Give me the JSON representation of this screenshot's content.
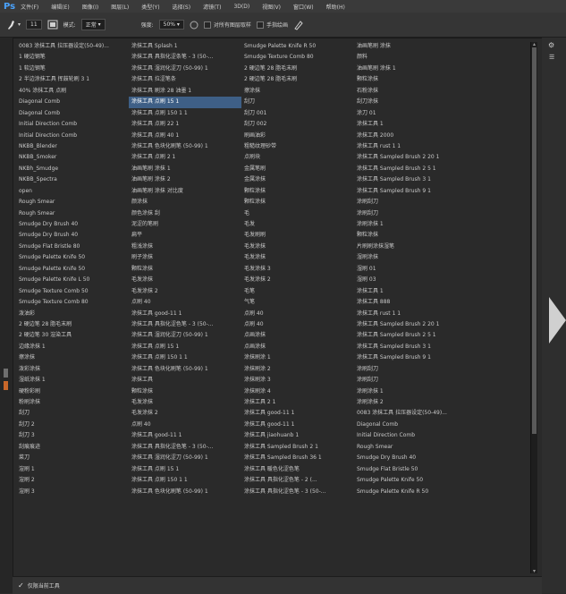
{
  "app": {
    "logo": "Ps"
  },
  "menu": [
    "文件(F)",
    "编辑(E)",
    "图像(I)",
    "图层(L)",
    "类型(Y)",
    "选择(S)",
    "滤镜(T)",
    "3D(D)",
    "视图(V)",
    "窗口(W)",
    "帮助(H)"
  ],
  "options": {
    "brush_size": "11",
    "mode_label": "模式:",
    "mode_value": "正常",
    "strength_label": "强度:",
    "strength_value": "50%",
    "sample_all_label": "对所有图层取样",
    "finger_label": "手指绘画"
  },
  "presets": {
    "columns": [
      [
        "0083 涂抹工具 拉压器设定(50-49)...",
        "1 硬边钢笔",
        "1 软边钢笔",
        "2 半边涂抹工具 挥鼓轮刷 3 1",
        "40% 涂抹工具 点刷",
        "Diagonal Comb",
        "Diagonal Comb",
        "Initial Direction Comb",
        "Initial Direction Comb",
        "NKBB_Blender",
        "NKBB_Smoker",
        "NKBh_Smudge",
        "NKBB_Spectra",
        "open",
        "Rough Smear",
        "Rough Smear",
        "Smudge Dry Brush 40",
        "Smudge Dry Brush 40",
        "Smudge Flat Bristle 80",
        "Smudge Palette Knife 50",
        "Smudge Palette Knife 50",
        "Smudge Palette Knife L 50",
        "Smudge Texture Comb 50",
        "Smudge Texture Comb 80",
        "泼油彩",
        "2 硬边笔 28 脂毛末刷",
        "2 硬边笔 30 渲染工具",
        "边缘涂抹 1",
        "擦涂抹",
        "泼彩涂抹",
        "湿纸涂抹 1",
        "硬粉彩刷",
        "粉刷涂抹",
        "刮刀",
        "刮刀 2",
        "刮刀 3",
        "刮痕痕迹",
        "菜刀",
        "渲刷 1",
        "渲刷 2",
        "渲刷 3"
      ],
      [
        "涂抹工具 Splash 1",
        "涂抹工具 具指化涩条笔 - 3 (50-...",
        "涂抹工具 湿润化涩刀 (50-99) 1",
        "涂抹工具 拉涩笔条",
        "涂抹工具 刷涂 28 油墨 1",
        "涂抹工具 点刷 15 1",
        "涂抹工具 点刷 150 1 1",
        "涂抹工具 点刷 22 1",
        "涂抹工具 点刷 40 1",
        "涂抹工具 色块化刷笔 (50-99) 1",
        "涂抹工具 点刷 2 1",
        "油画笔刷 涂抹 1",
        "油画笔刷 涂抹 2",
        "油画笔刷 涂抹 对比度",
        "颜涂抹",
        "颜色涂抹 刮",
        "泥涩的笔刷",
        "扁平",
        "粗浅涂抹",
        "刷子涂抹",
        "颗粒涂抹",
        "毛发涂抹",
        "毛发涂抹 2",
        "点刷 40",
        "涂抹工具 good-11 1",
        "涂抹工具 具指化涩色笔 - 3 (50-...",
        "涂抹工具 湿润化涩刀 (50-99) 1",
        "涂抹工具 点刷 15 1",
        "涂抹工具 点刷 150 1 1",
        "涂抹工具 色块化刷笔 (50-99) 1",
        "涂抹工具",
        "颗粒涂抹",
        "毛发涂抹",
        "毛发涂抹 2",
        "点刷 40",
        "涂抹工具 good-11 1",
        "涂抹工具 具指化涩色笔 - 3 (50-...",
        "涂抹工具 湿润化涩刀 (50-99) 1",
        "涂抹工具 点刷 15 1",
        "涂抹工具 点刷 150 1 1",
        "涂抹工具 色块化刷笔 (50-99) 1"
      ],
      [
        "Smudge Palette Knife R 50",
        "Smudge Texture Comb 80",
        "2 硬边笔 28 脂毛末刷",
        "2 硬边笔 28 脂毛末刷",
        "擦涂抹",
        "刮刀",
        "刮刀 001",
        "刮刀 002",
        "刷画油彩",
        "粗糙纹理砂带",
        "点刷块",
        "金属笔刷",
        "金属涂抹",
        "颗粒涂抹",
        "颗粒涂抹",
        "毛",
        "毛发",
        "毛发刷刷",
        "毛发涂抹",
        "毛发涂抹",
        "毛发涂抹 3",
        "毛发涂抹 2",
        "毛笔",
        "气笔",
        "点刷 40",
        "点刷 40",
        "点画涂抹",
        "点画涂抹",
        "涂抹刷涂 1",
        "涂抹刷涂 2",
        "涂抹刷涂 3",
        "涂抹刷涂 4",
        "涂抹工具 2 1",
        "涂抹工具 good-11 1",
        "涂抹工具 good-11 1",
        "涂抹工具 jiaohuanb 1",
        "涂抹工具 Sampled Brush 2 1",
        "涂抹工具 Sampled Brush 36 1",
        "涂抹工具 暖色化涩色笔",
        "涂抹工具 具指化涩色笔 - 2 (...",
        "涂抹工具 具指化涩色笔 - 3 (50-..."
      ],
      [
        "油画笔刷 涂抹",
        "颜料",
        "油画笔刷 涂抹 1",
        "颗粒涂抹",
        "石粉涂抹",
        "刮刀涂抹",
        "涂刀 01",
        "涂抹工具 1",
        "涂抹工具 2000",
        "涂抹工具 rust 1 1",
        "涂抹工具 Sampled Brush 2 20 1",
        "涂抹工具 Sampled Brush 2 5 1",
        "涂抹工具 Sampled Brush 3 1",
        "涂抹工具 Sampled Brush 9 1",
        "涂刷刮刀",
        "涂刷刮刀",
        "涂刷涂抹 1",
        "颗粒涂抹",
        "片刷刷涂抹湿笔",
        "湿刷涂抹",
        "湿刷 01",
        "湿刷 03",
        "涂抹工具 1",
        "涂抹工具 888",
        "涂抹工具 rust 1 1",
        "涂抹工具 Sampled Brush 2 20 1",
        "涂抹工具 Sampled Brush 2 5 1",
        "涂抹工具 Sampled Brush 3 1",
        "涂抹工具 Sampled Brush 9 1",
        "涂刷刮刀",
        "涂刷刮刀",
        "涂刷涂抹 1",
        "涂刷涂抹 2",
        "0083 涂抹工具 拉压器设定(50-49)...",
        "Diagonal Comb",
        "Initial Direction Comb",
        "Rough Smear",
        "Smudge Dry Brush 40",
        "Smudge Flat Bristle 50",
        "Smudge Palette Knife 50",
        "Smudge Palette Knife R 50"
      ]
    ],
    "selected": "涂抹工具 点刷 15 1"
  },
  "footer": {
    "label": "仅限当前工具"
  }
}
